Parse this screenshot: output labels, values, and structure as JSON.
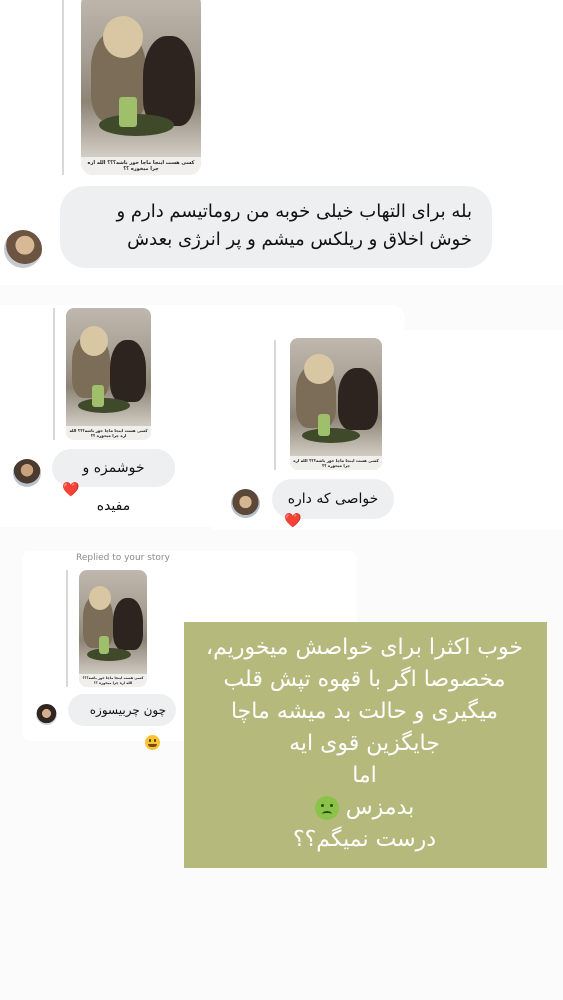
{
  "story_caption": "کسی هست اینجا ماچا خور باشه؟؟؟ الله اره چرا میخوره ؟؟",
  "message_1": {
    "lines": [
      "بله برای التهاب خیلی خوبه من روماتیسم دارم و",
      "خوش اخلاق و ریلکس میشم و پر انرژی بعدش"
    ]
  },
  "reply_left": {
    "text": "خوشمزه و مفیده",
    "reaction": "❤️"
  },
  "reply_right": {
    "text": "خواصی که داره",
    "reaction": "❤️"
  },
  "reply_bottom": {
    "label": "Replied to your story",
    "text": "چون چربیسوزه",
    "emoji": "grinning-sweat-emoji"
  },
  "olive_block": {
    "lines": [
      "خوب اکثرا برای خواصش میخوریم،",
      "مخصوصا اگر با قهوه تپش قلب",
      "میگیری و حالت بد میشه ماچا",
      "جایگزین قوی ایه",
      "اما",
      "بدمزس",
      "درست نمیگم؟؟"
    ],
    "emoji": "nauseated-face-emoji",
    "background": "#b5ba7c"
  }
}
